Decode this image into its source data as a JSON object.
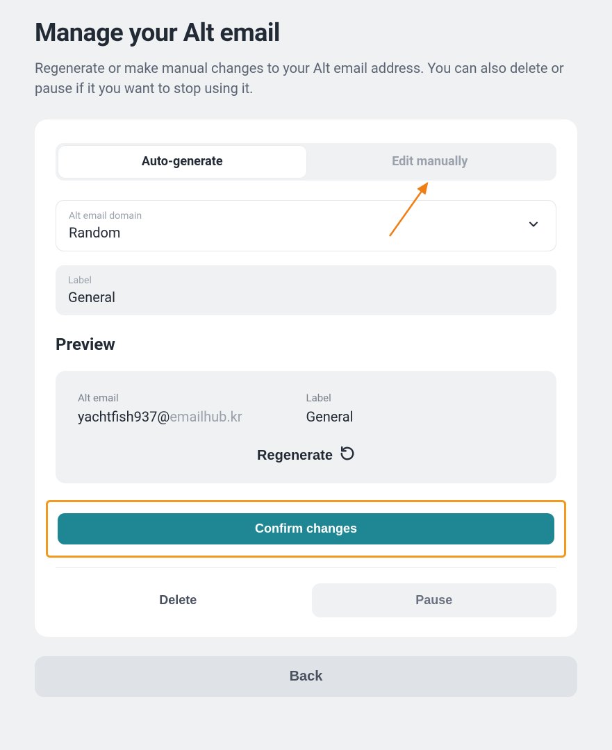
{
  "page": {
    "title": "Manage your Alt email",
    "subtitle": "Regenerate or make manual changes to your Alt email address. You can also delete or pause if it you want to stop using it."
  },
  "tabs": {
    "auto": "Auto-generate",
    "manual": "Edit manually"
  },
  "domainField": {
    "label": "Alt email domain",
    "value": "Random"
  },
  "labelField": {
    "label": "Label",
    "value": "General"
  },
  "preview": {
    "heading": "Preview",
    "altEmailLabel": "Alt email",
    "altEmailLocal": "yachtfish937@",
    "altEmailDomain": "emailhub.kr",
    "labelLabel": "Label",
    "labelValue": "General",
    "regenerate": "Regenerate"
  },
  "buttons": {
    "confirm": "Confirm changes",
    "delete": "Delete",
    "pause": "Pause",
    "back": "Back"
  }
}
